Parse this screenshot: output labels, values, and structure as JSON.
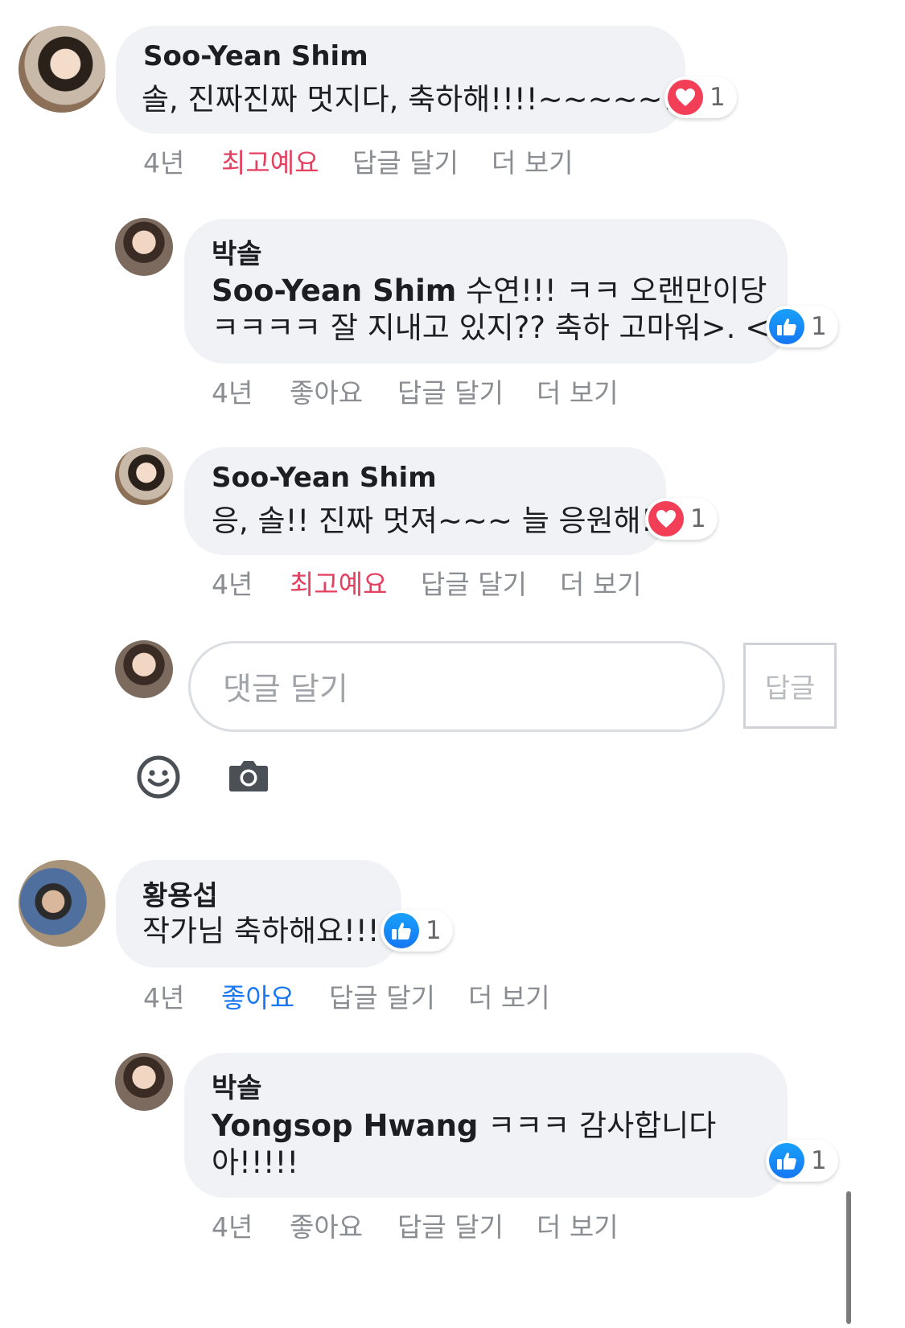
{
  "comments": [
    {
      "author": "Soo-Yean Shim",
      "text": "솔, 진짜진짜 멋지다, 축하해!!!!~~~~~!!!",
      "reaction": {
        "type": "heart",
        "count": "1"
      },
      "time": "4년",
      "like_label": "최고예요",
      "reply_label": "답글 달기",
      "more_label": "더 보기"
    },
    {
      "author": "박솔",
      "mention": "Soo-Yean Shim",
      "text_line1": " 수연!!! ㅋㅋ 오랜만이당",
      "text_line2": "ㅋㅋㅋㅋ 잘 지내고 있지?? 축하 고마워>. <",
      "reaction": {
        "type": "like",
        "count": "1"
      },
      "time": "4년",
      "like_label": "좋아요",
      "reply_label": "답글 달기",
      "more_label": "더 보기"
    },
    {
      "author": "Soo-Yean Shim",
      "text": "응, 솔!! 진짜 멋져~~~ 늘 응원해!!",
      "reaction": {
        "type": "heart",
        "count": "1"
      },
      "time": "4년",
      "like_label": "최고예요",
      "reply_label": "답글 달기",
      "more_label": "더 보기"
    },
    {
      "author": "황용섭",
      "text": "작가님 축하해요!!!",
      "reaction": {
        "type": "like",
        "count": "1"
      },
      "time": "4년",
      "like_label": "좋아요",
      "reply_label": "답글 달기",
      "more_label": "더 보기"
    },
    {
      "author": "박솔",
      "mention": "Yongsop Hwang",
      "text_line1": " ㅋㅋㅋ 감사합니다",
      "text_line2": "아!!!!!",
      "reaction": {
        "type": "like",
        "count": "1"
      },
      "time": "4년",
      "like_label": "좋아요",
      "reply_label": "답글 달기",
      "more_label": "더 보기"
    }
  ],
  "composer": {
    "placeholder": "댓글 달기",
    "submit_label": "답글",
    "icons": [
      "smiley-icon",
      "camera-icon"
    ]
  },
  "colors": {
    "bubble": "#f0f2f5",
    "love_red": "#e4405f",
    "like_blue": "#1877f2",
    "meta_gray": "#8a8d91"
  }
}
